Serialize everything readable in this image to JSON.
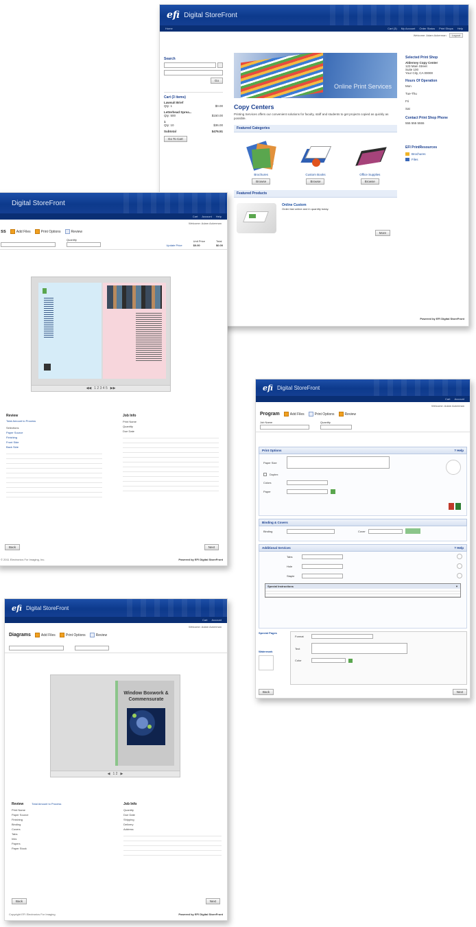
{
  "brand": {
    "logo": "efi",
    "name": "Digital StoreFront"
  },
  "top_card": {
    "welcome": "Welcome: Adam Ackerman",
    "logout": "Logout",
    "search": {
      "heading": "Search",
      "go": "Go"
    },
    "cart": {
      "heading": "Cart (3 items)",
      "items": [
        {
          "name": "Lawsuit Brief",
          "qty": "Qty: 1",
          "price": "$0.00"
        },
        {
          "name": "Letterhead Sprea...",
          "qty": "Qty: 500",
          "price": "$150.00"
        },
        {
          "name": "1",
          "qty": "Qty: 10",
          "price": "$36.00"
        }
      ],
      "subtotal_label": "Subtotal",
      "subtotal": "$476.51",
      "checkout": "Go To Cart"
    },
    "banner_text": "Online Print Services",
    "page_title": "Copy Centers",
    "page_intro": "Printing Services offers our convenient solutions for faculty, staff and students to get projects copied as quickly as possible.",
    "featured_categories": "Featured Categories",
    "categories": [
      {
        "name": "Brochures",
        "button": "Browse"
      },
      {
        "name": "Custom Books",
        "button": "Browse"
      },
      {
        "name": "Office Supplies",
        "button": "Browse"
      }
    ],
    "featured_products": "Featured Products",
    "product": {
      "name": "Online Custom",
      "desc": "Order fast online and in quantity today.",
      "button": "More"
    },
    "right": {
      "store_heading": "Selected Print Shop",
      "store_name": "Alderney Copy Center",
      "store_lines": [
        "123 Main Street",
        "Suite 100",
        "Your City, CA 00000"
      ],
      "hours_heading": "Hours Of Operation",
      "hours": [
        "Mon",
        "Tue-Thu",
        "Fri",
        "Sat"
      ],
      "contact_heading": "Contact Print Shop Phone",
      "contact": "555 555 5555",
      "efi_heading": "EFI PrintResources",
      "efi_items": [
        "Brochures",
        "Files"
      ]
    },
    "footer_left": "Copyright Info",
    "footer_right": "Powered by EFI Digital StoreFront"
  },
  "mid_card": {
    "welcome": "Welcome: Adam Ackerman",
    "steps_title": "ss",
    "steps": [
      "Add Files",
      "Print Options",
      "Review"
    ],
    "field_quantity": "Quantity",
    "link": "Update Price",
    "col1": "Unit Price",
    "col2": "Total",
    "pager": "1 2 3 4 5",
    "summary": {
      "heading": "Review",
      "sub": "Total Amount to Process",
      "lines": [
        "Selections",
        "Paper Source",
        "Finishing",
        "Front Side",
        "Back Side"
      ],
      "right_heading": "Job Info",
      "right_lines": [
        "Print Name",
        "Quantity",
        "Due Date"
      ]
    },
    "footer_left": "© 2011 Electronics For Imaging, Inc.",
    "footer_right": "Powered by EFI Digital StoreFront",
    "btn_left": "Back",
    "btn_right": "Next"
  },
  "right_card": {
    "welcome": "Welcome: Adam Ackerman",
    "steps_title": "Program",
    "steps": [
      "Add Files",
      "Print Options",
      "Review"
    ],
    "field_name": "Job Name",
    "field_qty": "Quantity",
    "panels": [
      "Print Options",
      "Binding & Covers",
      "Additional Services"
    ],
    "colors_label": "Colors",
    "paper_label": "Paper",
    "dropdown_title": "Special Instructions",
    "bottom_labels": [
      "Special Pages",
      "Watermark"
    ],
    "btn_left": "Back",
    "btn_right": "Next"
  },
  "bottom_card": {
    "welcome": "Welcome: Adam Ackerman",
    "steps_title": "Diagrams",
    "steps": [
      "Add Files",
      "Print Options",
      "Review"
    ],
    "book_title": "Window Boxwork & Commensurate",
    "pager": "1 2",
    "summary_heading": "Review",
    "summary_sub": "Total Amount to Process",
    "left_lines": [
      "Print Name",
      "Paper Source",
      "Finishing",
      "Binding",
      "Covers",
      "Tabs",
      "Inks",
      "Papers",
      "Paper Stock"
    ],
    "right_heading": "Job Info",
    "right_lines": [
      "Quantity",
      "Due Date",
      "Shipping",
      "Delivery",
      "Address"
    ],
    "btn_left": "Back",
    "btn_right": "Next",
    "footer_left": "Copyright EFI Electronics For Imaging",
    "footer_right": "Powered by EFI Digital StoreFront"
  },
  "colors": {
    "brand": "#0d3a8c",
    "accent": "#f0a020",
    "link": "#1b4ea0"
  }
}
